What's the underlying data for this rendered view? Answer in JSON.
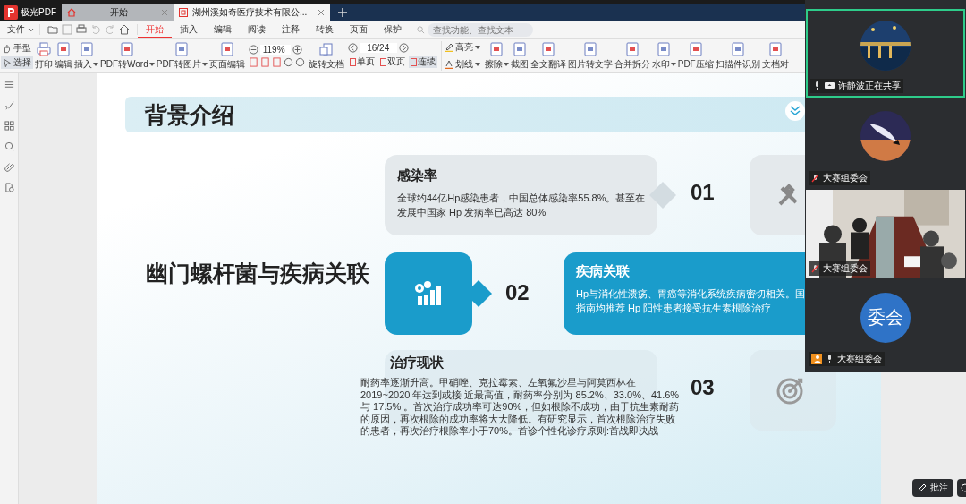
{
  "app": {
    "name": "极光PDF"
  },
  "doc_tabs": [
    {
      "label": "开始",
      "selected": false
    },
    {
      "label": "湖州溪如奇医疗技术有限公...",
      "selected": true
    }
  ],
  "menu": {
    "file": "文件",
    "tabs": [
      {
        "label": "开始",
        "selected": true
      },
      {
        "label": "插入",
        "selected": false
      },
      {
        "label": "编辑",
        "selected": false
      },
      {
        "label": "阅读",
        "selected": false
      },
      {
        "label": "注释",
        "selected": false
      },
      {
        "label": "转换",
        "selected": false
      },
      {
        "label": "页面",
        "selected": false
      },
      {
        "label": "保护",
        "selected": false
      }
    ]
  },
  "search": {
    "placeholder": "查找功能、查找文本"
  },
  "toolbar": {
    "modes": [
      {
        "label": "手型",
        "selected": false
      },
      {
        "label": "选择",
        "selected": true
      }
    ],
    "tools_left": [
      {
        "label": "打印",
        "dropdown": false
      },
      {
        "label": "编辑",
        "dropdown": false
      },
      {
        "label": "插入",
        "dropdown": true
      },
      {
        "label": "PDF转Word",
        "dropdown": true
      },
      {
        "label": "PDF转图片",
        "dropdown": true
      },
      {
        "label": "页面编辑",
        "dropdown": false
      }
    ],
    "zoom": "119%",
    "rotate": "旋转文档",
    "page": "16/24",
    "views": [
      {
        "label": "单页",
        "selected": false
      },
      {
        "label": "双页",
        "selected": false
      },
      {
        "label": "连续",
        "selected": true
      }
    ],
    "marks": [
      {
        "label": "高亮"
      },
      {
        "label": "划线"
      }
    ],
    "tools_right": [
      {
        "label": "擦除",
        "dropdown": true
      },
      {
        "label": "截图",
        "dropdown": false
      },
      {
        "label": "全文翻译",
        "dropdown": false
      },
      {
        "label": "图片转文字",
        "dropdown": false
      },
      {
        "label": "合并拆分",
        "dropdown": false
      },
      {
        "label": "水印",
        "dropdown": true
      },
      {
        "label": "PDF压缩",
        "dropdown": false
      },
      {
        "label": "扫描件识别",
        "dropdown": false
      },
      {
        "label": "文档对",
        "dropdown": false
      }
    ]
  },
  "slide": {
    "header": "背景介绍",
    "title": "幽门螺杆菌与疾病关联",
    "items": [
      {
        "number": "01",
        "heading": "感染率",
        "lines": [
          "全球约44亿Hp感染患者，中国总体感染率55.8%。甚至在",
          "发展中国家 Hp 发病率已高达 80%"
        ],
        "highlighted": false
      },
      {
        "number": "02",
        "heading": "疾病关联",
        "lines": [
          "Hp与消化性溃疡、胃癌等消化系统疾病密切相关。国",
          "指南均推荐 Hp 阳性患者接受抗生素根除治疗"
        ],
        "highlighted": true
      },
      {
        "number": "03",
        "heading": "治疗现状",
        "lines": [
          "耐药率逐渐升高。甲硝唑、克拉霉素、左氧氟沙星与阿莫西林在",
          "2019~2020 年达到或接 近最高值，耐药率分别为 85.2%、33.0%、41.6%",
          "与 17.5% 。首次治疗成功率可达90%，但如根除不成功，由于抗生素耐药",
          "的原因，再次根除的成功率将大大降低。有研究显示，首次根除治疗失败",
          "的患者，再次治疗根除率小于70%。首诊个性化诊疗原则:首战即决战"
        ],
        "highlighted": false
      }
    ]
  },
  "participants": [
    {
      "label": "许静波正在共享",
      "muted": false,
      "sharing": true,
      "speaking": true,
      "kind": "avatar"
    },
    {
      "label": "大赛组委会",
      "muted": true,
      "sharing": false,
      "speaking": false,
      "kind": "avatar"
    },
    {
      "label": "大赛组委会",
      "muted": true,
      "sharing": false,
      "speaking": false,
      "kind": "video"
    },
    {
      "label": "大赛组委会",
      "muted": false,
      "sharing": false,
      "speaking": false,
      "kind": "initials",
      "initials": "委会"
    }
  ],
  "annotate_button": "批注"
}
